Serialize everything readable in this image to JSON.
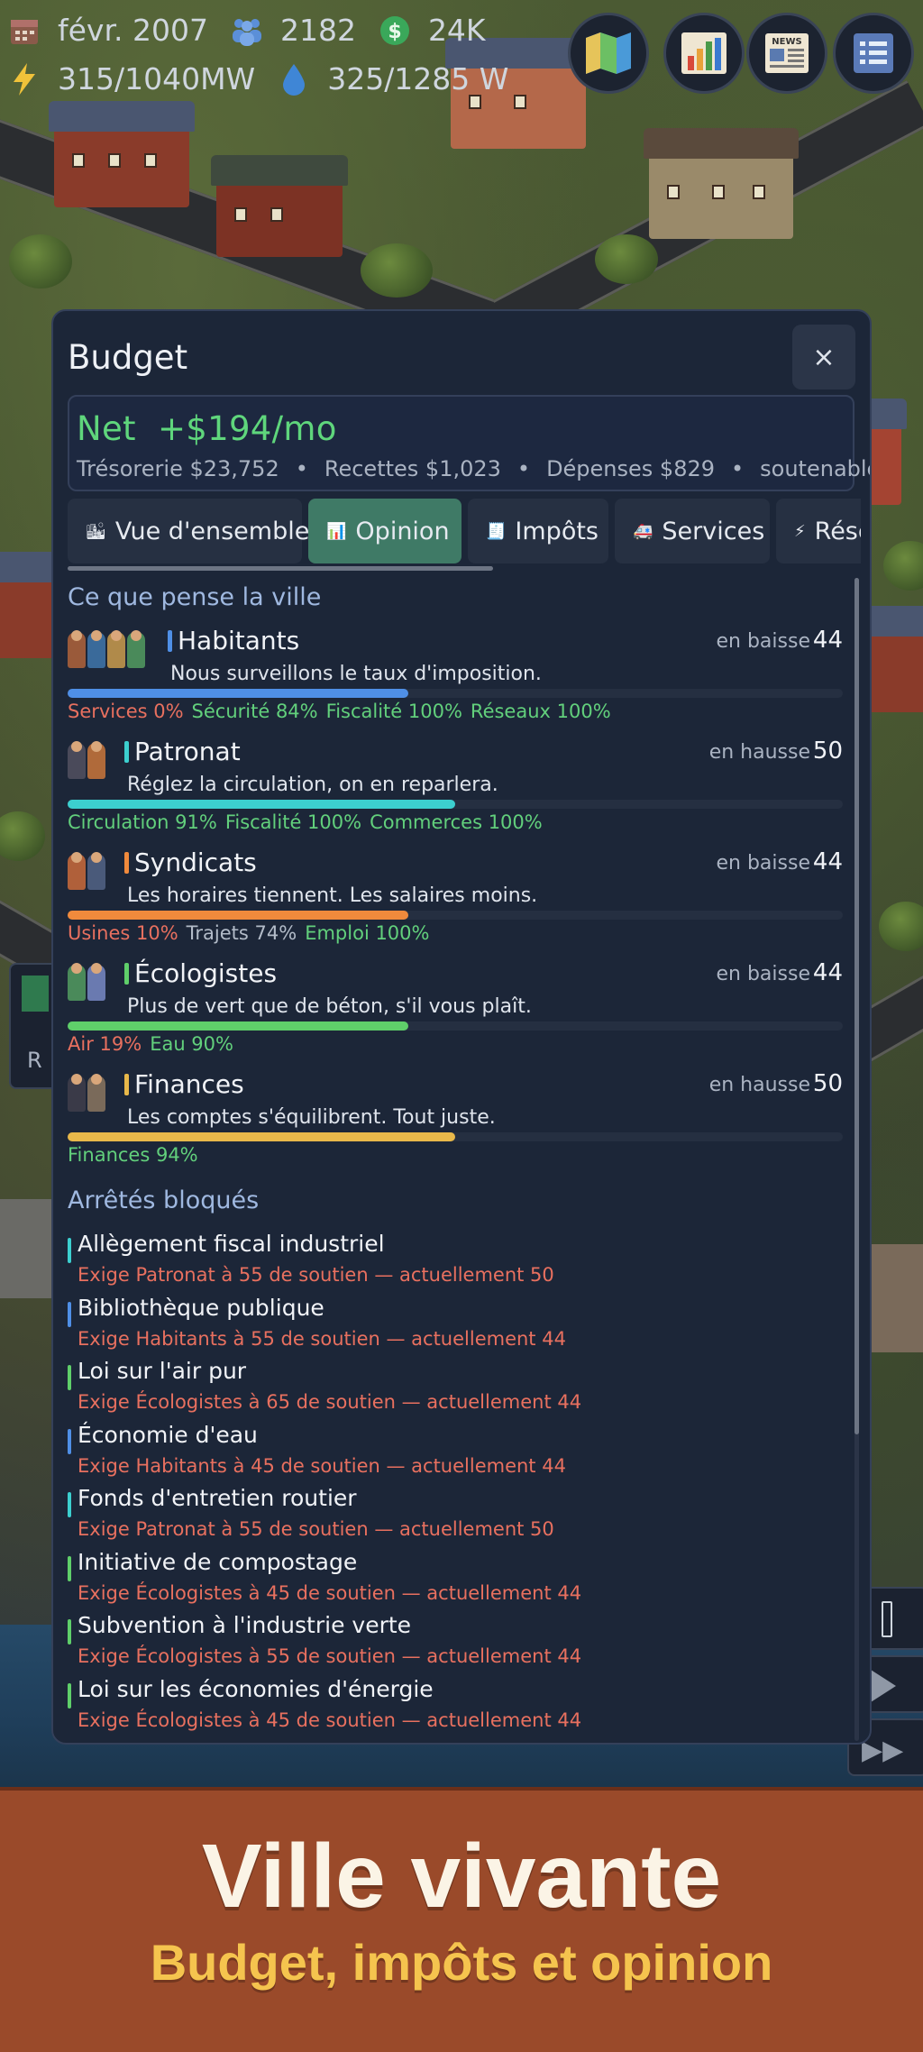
{
  "hud": {
    "date": "févr. 2007",
    "population": "2182",
    "money": "24K",
    "power": "315/1040MW",
    "water": "325/1285 W",
    "icons": [
      "calendar-icon",
      "people-icon",
      "dollar-icon",
      "lightning-icon",
      "water-drop-icon"
    ],
    "buttons": [
      "map-icon",
      "chart-icon",
      "news-icon",
      "list-icon"
    ],
    "news_label": "NEWS"
  },
  "side": {
    "letter": "R"
  },
  "budget": {
    "title": "Budget",
    "close": "×",
    "net": "Net  +$194/mo",
    "tresorerie": "Trésorerie $23,752",
    "recettes": "Recettes $1,023",
    "depenses": "Dépenses $829",
    "status": "soutenable",
    "separator": "•",
    "tabs": [
      {
        "label": "Vue d'ensemble",
        "icon": "🏙"
      },
      {
        "label": "Opinion",
        "icon": "📊"
      },
      {
        "label": "Impôts",
        "icon": "🧾"
      },
      {
        "label": "Services",
        "icon": "🚑"
      },
      {
        "label": "Rése",
        "icon": "⚡"
      }
    ],
    "active_tab": "Opinion",
    "opinion": {
      "heading": "Ce que pense la ville",
      "groups": [
        {
          "name": "Habitants",
          "trend": "en baisse",
          "score": "44",
          "quote": "Nous surveillons le taux d'imposition.",
          "support": 0.44,
          "color": "#4f8fe6",
          "factors": [
            {
              "text": "Services 0%",
              "tone": "red"
            },
            {
              "text": "Sécurité 84%",
              "tone": "green"
            },
            {
              "text": "Fiscalité 100%",
              "tone": "green"
            },
            {
              "text": "Réseaux 100%",
              "tone": "green"
            }
          ]
        },
        {
          "name": "Patronat",
          "trend": "en hausse",
          "score": "50",
          "quote": "Réglez la circulation, on en reparlera.",
          "support": 0.5,
          "color": "#3ccfcf",
          "factors": [
            {
              "text": "Circulation 91%",
              "tone": "green"
            },
            {
              "text": "Fiscalité 100%",
              "tone": "green"
            },
            {
              "text": "Commerces 100%",
              "tone": "green"
            }
          ]
        },
        {
          "name": "Syndicats",
          "trend": "en baisse",
          "score": "44",
          "quote": "Les horaires tiennent. Les salaires moins.",
          "support": 0.44,
          "color": "#f08a3c",
          "factors": [
            {
              "text": "Usines 10%",
              "tone": "red"
            },
            {
              "text": "Trajets 74%",
              "tone": "gray"
            },
            {
              "text": "Emploi 100%",
              "tone": "green"
            }
          ]
        },
        {
          "name": "Écologistes",
          "trend": "en baisse",
          "score": "44",
          "quote": "Plus de vert que de béton, s'il vous plaît.",
          "support": 0.44,
          "color": "#5fcf6a",
          "factors": [
            {
              "text": "Air 19%",
              "tone": "red"
            },
            {
              "text": "Eau 90%",
              "tone": "green"
            }
          ]
        },
        {
          "name": "Finances",
          "trend": "en hausse",
          "score": "50",
          "quote": "Les comptes s'équilibrent. Tout juste.",
          "support": 0.5,
          "color": "#e8b84a",
          "factors": [
            {
              "text": "Finances 94%",
              "tone": "green"
            }
          ]
        }
      ]
    },
    "blocked": {
      "heading": "Arrêtés bloqués",
      "items": [
        {
          "name": "Allègement fiscal industriel",
          "req": "Exige Patronat à 55 de soutien — actuellement 50",
          "color": "#3ccfcf"
        },
        {
          "name": "Bibliothèque publique",
          "req": "Exige Habitants à 55 de soutien — actuellement 44",
          "color": "#4f8fe6"
        },
        {
          "name": "Loi sur l'air pur",
          "req": "Exige Écologistes à 65 de soutien — actuellement 44",
          "color": "#5fcf6a"
        },
        {
          "name": "Économie d'eau",
          "req": "Exige Habitants à 45 de soutien — actuellement 44",
          "color": "#4f8fe6"
        },
        {
          "name": "Fonds d'entretien routier",
          "req": "Exige Patronat à 55 de soutien — actuellement 50",
          "color": "#3ccfcf"
        },
        {
          "name": "Initiative de compostage",
          "req": "Exige Écologistes à 45 de soutien — actuellement 44",
          "color": "#5fcf6a"
        },
        {
          "name": "Subvention à l'industrie verte",
          "req": "Exige Écologistes à 55 de soutien — actuellement 44",
          "color": "#5fcf6a"
        },
        {
          "name": "Loi sur les économies d'énergie",
          "req": "Exige Écologistes à 45 de soutien — actuellement 44",
          "color": "#5fcf6a"
        }
      ]
    }
  },
  "banner": {
    "title": "Ville vivante",
    "subtitle": "Budget, impôts et opinion"
  }
}
